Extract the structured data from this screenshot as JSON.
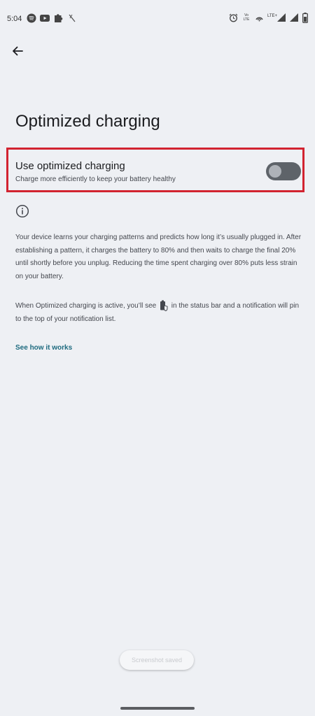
{
  "status_bar": {
    "time": "5:04",
    "lte_small_top": "Vo",
    "lte_small_bottom": "LTE",
    "lte_plus": "LTE+"
  },
  "page": {
    "title": "Optimized charging"
  },
  "setting": {
    "title": "Use optimized charging",
    "subtitle": "Charge more efficiently to keep your battery healthy",
    "toggle_on": false
  },
  "info": {
    "paragraph1": "Your device learns your charging patterns and predicts how long it’s usually plugged in. After establishing a pattern, it charges the battery to 80% and then waits to charge the final 20% until shortly before you unplug. Reducing the time spent charging over 80% puts less strain on your battery.",
    "paragraph2_before": "When Optimized charging is active, you’ll see",
    "paragraph2_after": "in the status bar and a notification will pin to the top of your notification list.",
    "link": "See how it works"
  },
  "toast": {
    "text": "Screenshot saved"
  },
  "colors": {
    "background": "#eef0f4",
    "highlight_border": "#d22330",
    "link": "#1d6a7f",
    "toggle_track": "#5e6369"
  }
}
